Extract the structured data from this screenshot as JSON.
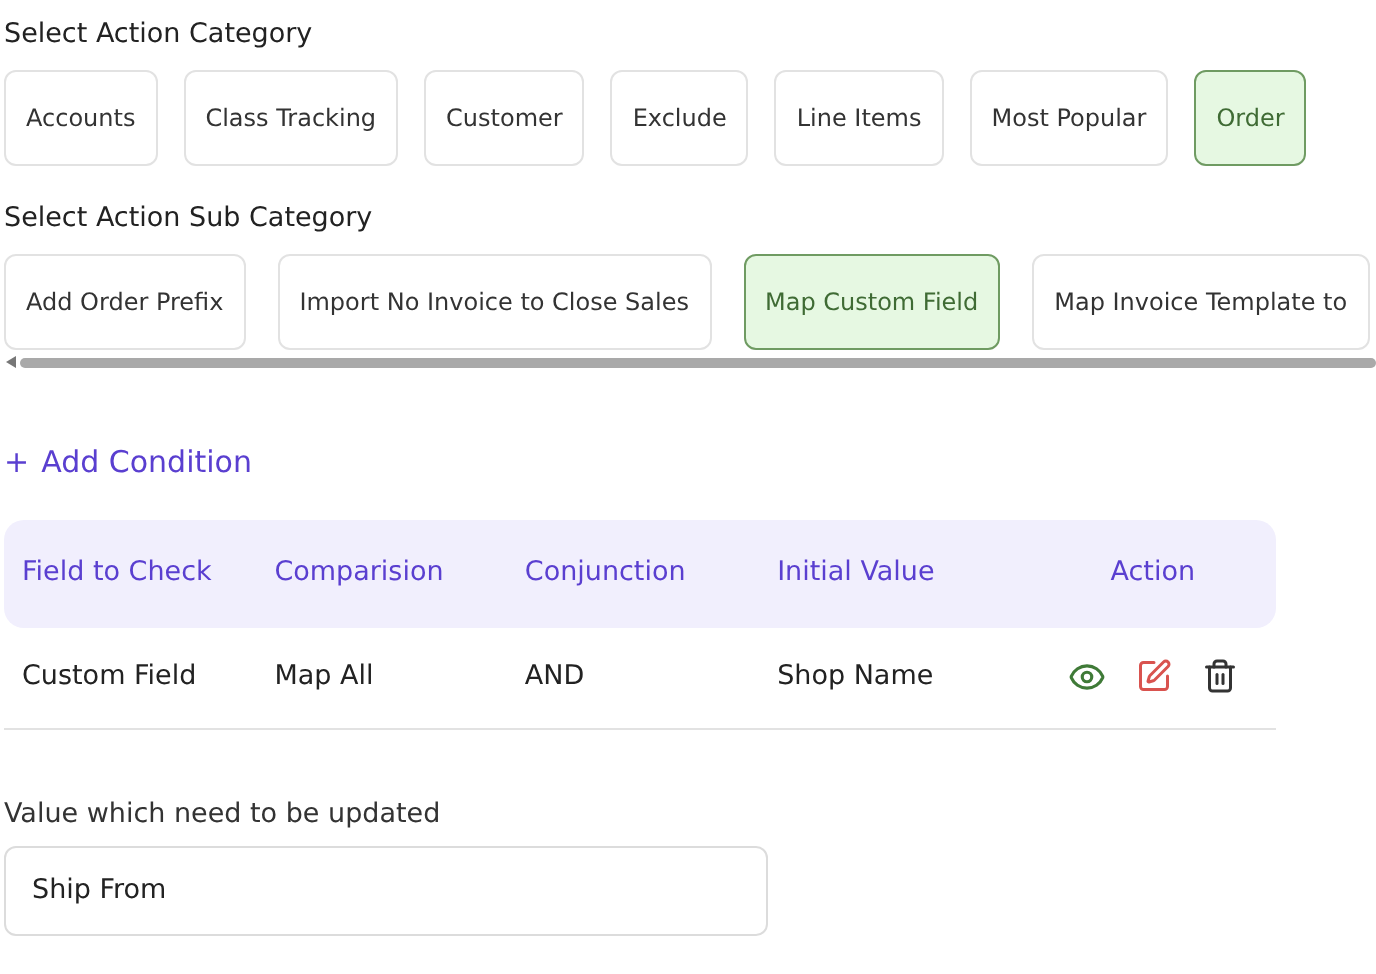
{
  "category_heading": "Select Action Category",
  "categories": [
    {
      "label": "Accounts",
      "selected": false
    },
    {
      "label": "Class Tracking",
      "selected": false
    },
    {
      "label": "Customer",
      "selected": false
    },
    {
      "label": "Exclude",
      "selected": false
    },
    {
      "label": "Line Items",
      "selected": false
    },
    {
      "label": "Most Popular",
      "selected": false
    },
    {
      "label": "Order",
      "selected": true
    }
  ],
  "sub_category_heading": "Select Action Sub Category",
  "sub_categories": [
    {
      "label": "Add Order Prefix",
      "selected": false
    },
    {
      "label": "Import No Invoice to Close Sales",
      "selected": false
    },
    {
      "label": "Map Custom Field",
      "selected": true
    },
    {
      "label": "Map Invoice Template to",
      "selected": false
    }
  ],
  "add_condition": {
    "icon": "+",
    "label": "Add Condition"
  },
  "table": {
    "columns": [
      "Field to Check",
      "Comparision",
      "Conjunction",
      "Initial Value",
      "Action"
    ],
    "rows": [
      {
        "cells": [
          "Custom Field",
          "Map All",
          "AND",
          "Shop Name"
        ]
      }
    ]
  },
  "update_field": {
    "label": "Value which need to be updated",
    "value": "Ship From"
  }
}
